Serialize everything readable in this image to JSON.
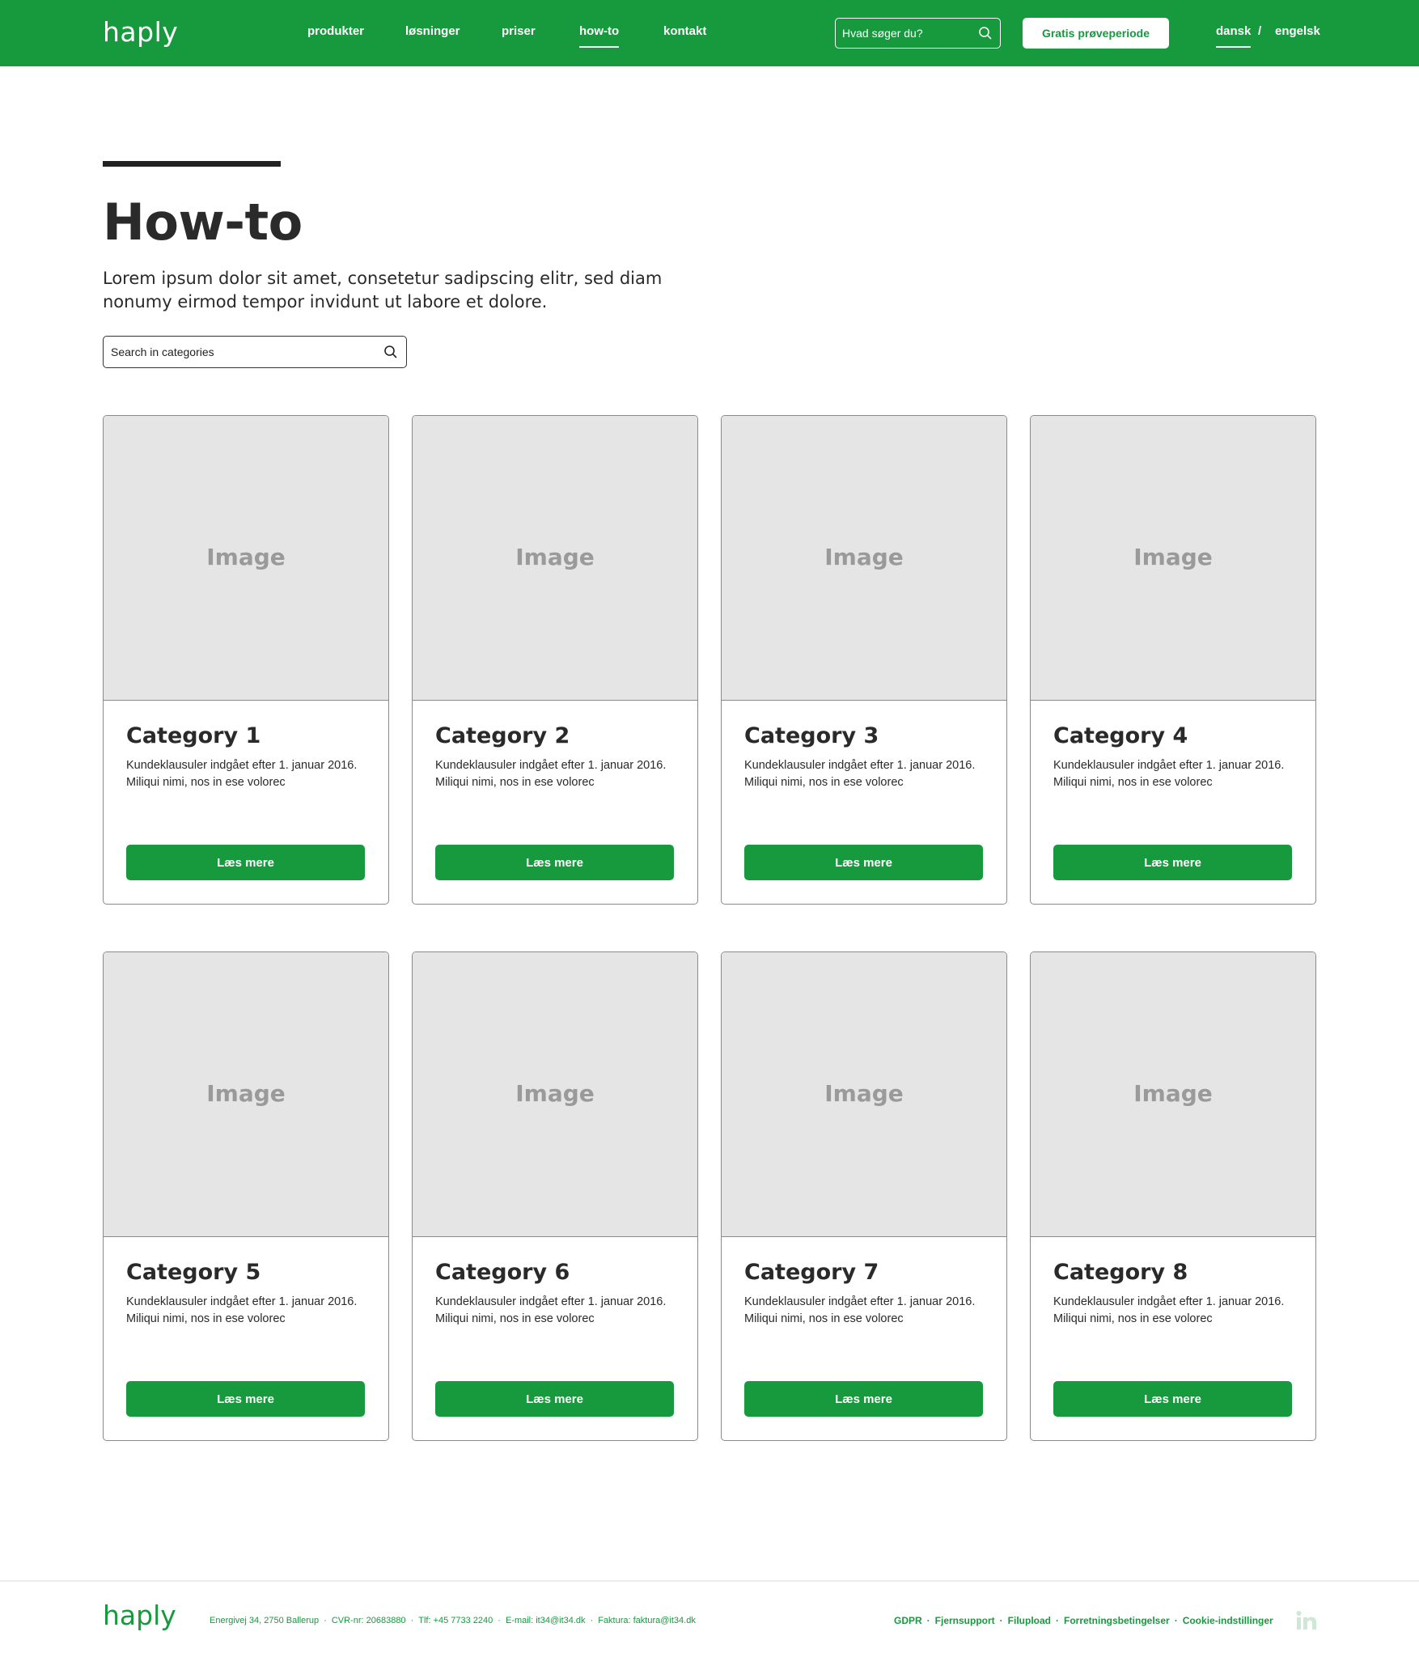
{
  "header": {
    "logo": "haply",
    "nav": [
      "produkter",
      "løsninger",
      "priser",
      "how-to",
      "kontakt"
    ],
    "search_placeholder": "Hvad søger du?",
    "trial_button": "Gratis prøveperiode",
    "lang_active": "dansk",
    "lang_separator": "/",
    "lang_other": "engelsk"
  },
  "hero": {
    "title": "How-to",
    "intro": "Lorem ipsum dolor sit amet, consetetur sadipscing elitr, sed diam nonumy eirmod tempor invidunt ut labore et dolore.",
    "search_placeholder": "Search in categories"
  },
  "cards": [
    {
      "image": "Image",
      "title": "Category 1",
      "text": "Kundeklausuler indgået efter 1. januar 2016. Miliqui nimi, nos in ese volorec",
      "button": "Læs mere"
    },
    {
      "image": "Image",
      "title": "Category 2",
      "text": "Kundeklausuler indgået efter 1. januar 2016. Miliqui nimi, nos in ese volorec",
      "button": "Læs mere"
    },
    {
      "image": "Image",
      "title": "Category 3",
      "text": "Kundeklausuler indgået efter 1. januar 2016. Miliqui nimi, nos in ese volorec",
      "button": "Læs mere"
    },
    {
      "image": "Image",
      "title": "Category 4",
      "text": "Kundeklausuler indgået efter 1. januar 2016. Miliqui nimi, nos in ese volorec",
      "button": "Læs mere"
    },
    {
      "image": "Image",
      "title": "Category 5",
      "text": "Kundeklausuler indgået efter 1. januar 2016. Miliqui nimi, nos in ese volorec",
      "button": "Læs mere"
    },
    {
      "image": "Image",
      "title": "Category 6",
      "text": "Kundeklausuler indgået efter 1. januar 2016. Miliqui nimi, nos in ese volorec",
      "button": "Læs mere"
    },
    {
      "image": "Image",
      "title": "Category 7",
      "text": "Kundeklausuler indgået efter 1. januar 2016. Miliqui nimi, nos in ese volorec",
      "button": "Læs mere"
    },
    {
      "image": "Image",
      "title": "Category 8",
      "text": "Kundeklausuler indgået efter 1. januar 2016. Miliqui nimi, nos in ese volorec",
      "button": "Læs mere"
    }
  ],
  "footer": {
    "logo": "haply",
    "info": [
      "Energivej 34, 2750 Ballerup",
      "CVR-nr: 20683880",
      "Tlf: +45 7733 2240",
      "E-mail: it34@it34.dk",
      "Faktura: faktura@it34.dk"
    ],
    "links": [
      "GDPR",
      "Fjernsupport",
      "Filupload",
      "Forretningsbetingelser",
      "Cookie-indstillinger"
    ],
    "separator": "·",
    "social_icon": "linkedin-icon"
  },
  "colors": {
    "brand_green": "#169a3d",
    "image_placeholder": "#e5e5e5",
    "text_dark": "#2a2a2a"
  }
}
